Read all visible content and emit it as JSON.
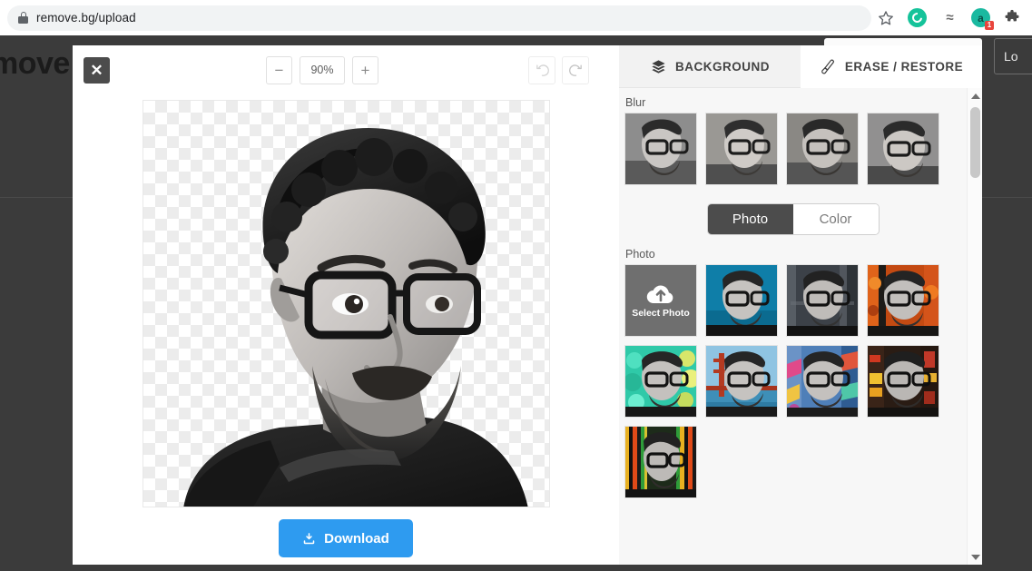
{
  "browser": {
    "url": "remove.bg/upload",
    "lock_icon": "lock-icon",
    "star_icon": "star-icon",
    "extensions": [
      {
        "name": "grammarly-extension-icon",
        "label": ""
      },
      {
        "name": "squiggle-extension-icon",
        "label": "≈"
      },
      {
        "name": "badged-extension-icon",
        "label": "a",
        "badge": "1"
      },
      {
        "name": "puzzle-extensions-icon",
        "label": ""
      }
    ]
  },
  "page_behind": {
    "brand_text": "move",
    "login_label": "Lo"
  },
  "editor": {
    "toolbar": {
      "close_label": "✕",
      "zoom_out_label": "−",
      "zoom_level": "90%",
      "zoom_in_label": "+",
      "undo_name": "undo-icon",
      "redo_name": "redo-icon"
    },
    "canvas": {
      "alt": "Grayscale portrait of bearded man with glasses, background removed",
      "transparency_pattern": "checkerboard"
    },
    "download_label": "Download",
    "tabs": [
      {
        "label": "BACKGROUND",
        "icon": "layers-icon",
        "active": true
      },
      {
        "label": "ERASE / RESTORE",
        "icon": "brush-icon",
        "active": false
      }
    ],
    "panel": {
      "blur_section_label": "Blur",
      "blur_thumbs": [
        {
          "name": "blur-thumb-1"
        },
        {
          "name": "blur-thumb-2"
        },
        {
          "name": "blur-thumb-3"
        },
        {
          "name": "blur-thumb-4"
        }
      ],
      "toggle": {
        "photo_label": "Photo",
        "color_label": "Color",
        "selected": "Photo"
      },
      "photo_section_label": "Photo",
      "select_photo_label": "Select Photo",
      "photo_thumbs": [
        {
          "name": "photo-thumb-blue-studio",
          "bg": "#0f7ea8"
        },
        {
          "name": "photo-thumb-urban-alley",
          "bg": "#3c4148"
        },
        {
          "name": "photo-thumb-autumn-orange",
          "bg": "#c44a12"
        },
        {
          "name": "photo-thumb-teal-bokeh",
          "bg": "#2fc9a8"
        },
        {
          "name": "photo-thumb-golden-gate",
          "bg": "#6fb4d8"
        },
        {
          "name": "photo-thumb-graffiti-wall",
          "bg": "#4f7fb8"
        },
        {
          "name": "photo-thumb-neon-street",
          "bg": "#2a1c14"
        },
        {
          "name": "photo-thumb-color-stripes",
          "bg": "#1d2b1a"
        }
      ]
    },
    "scrollbar": {
      "up_label": "▲",
      "down_label": "▼"
    }
  },
  "colors": {
    "accent_blue": "#2e9bf0",
    "dark_gray": "#4c4c4c",
    "panel_bg": "#f7f7f7",
    "page_backdrop": "#3b3b3b",
    "badge_red": "#e8453c",
    "grammarly_green": "#15c39a"
  }
}
